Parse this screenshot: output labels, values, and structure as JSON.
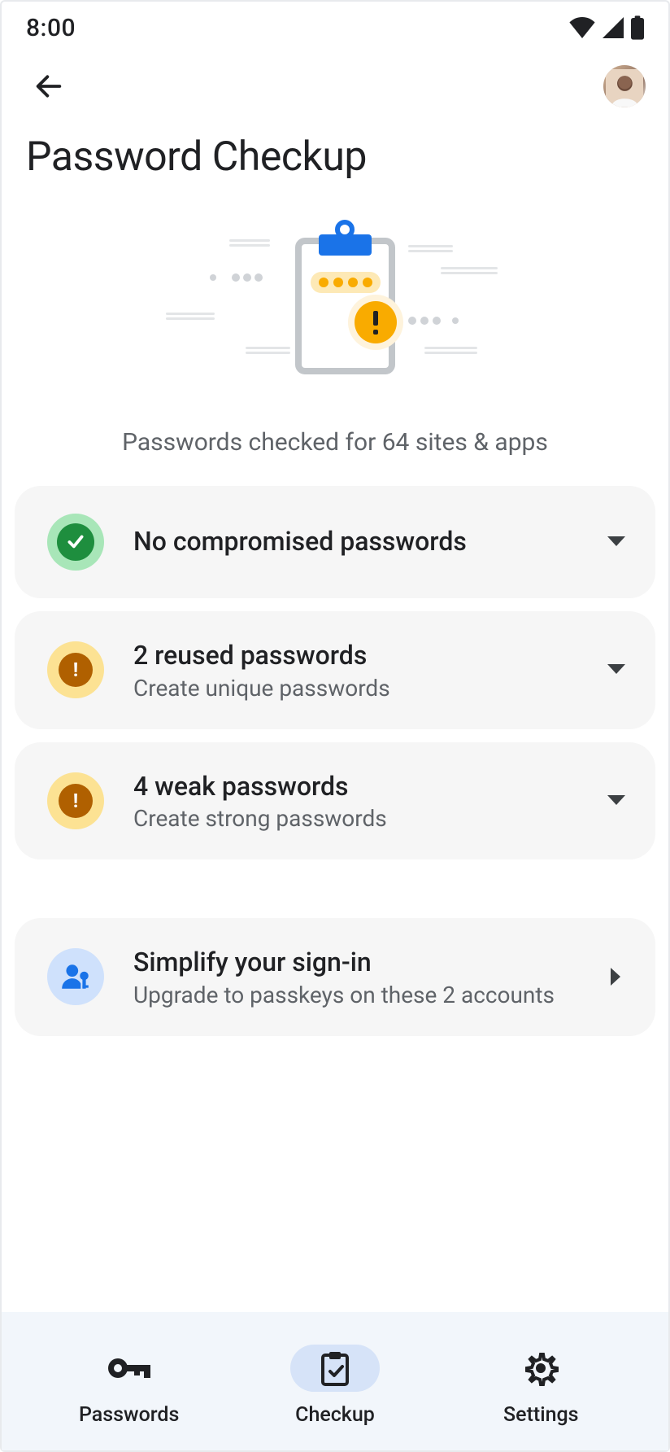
{
  "status": {
    "time": "8:00"
  },
  "page": {
    "title": "Password Checkup",
    "summary": "Passwords checked for 64 sites & apps"
  },
  "cards": {
    "compromised": {
      "title": "No compromised passwords"
    },
    "reused": {
      "title": "2 reused passwords",
      "subtitle": "Create unique passwords"
    },
    "weak": {
      "title": "4 weak passwords",
      "subtitle": "Create strong passwords"
    },
    "passkeys": {
      "title": "Simplify your sign-in",
      "subtitle": "Upgrade to passkeys on these 2 accounts"
    }
  },
  "nav": {
    "passwords": "Passwords",
    "checkup": "Checkup",
    "settings": "Settings"
  }
}
